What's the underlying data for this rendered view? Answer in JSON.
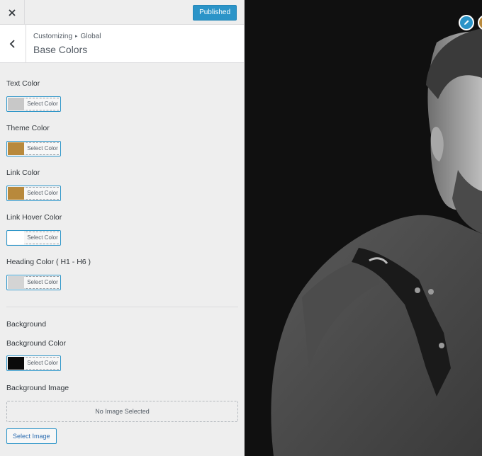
{
  "topbar": {
    "publish_label": "Published"
  },
  "section": {
    "breadcrumb_parent": "Customizing",
    "breadcrumb_child": "Global",
    "title": "Base Colors"
  },
  "controls": {
    "select_color_label": "Select Color",
    "colors": [
      {
        "label": "Text Color",
        "value": "#c8c8c8"
      },
      {
        "label": "Theme Color",
        "value": "#b8893c"
      },
      {
        "label": "Link Color",
        "value": "#b8893c"
      },
      {
        "label": "Link Hover Color",
        "value": "#ffffff"
      },
      {
        "label": "Heading Color ( H1 - H6 )",
        "value": "#d4d4d4"
      }
    ],
    "background_heading": "Background",
    "background_color": {
      "label": "Background Color",
      "value": "#0a0a0a"
    },
    "background_image": {
      "label": "Background Image",
      "empty_text": "No Image Selected",
      "button_label": "Select Image"
    }
  },
  "accent_color": "#2b94c8",
  "icons": {
    "close": "close-icon",
    "back": "chevron-left-icon",
    "edit": "pencil-icon"
  }
}
